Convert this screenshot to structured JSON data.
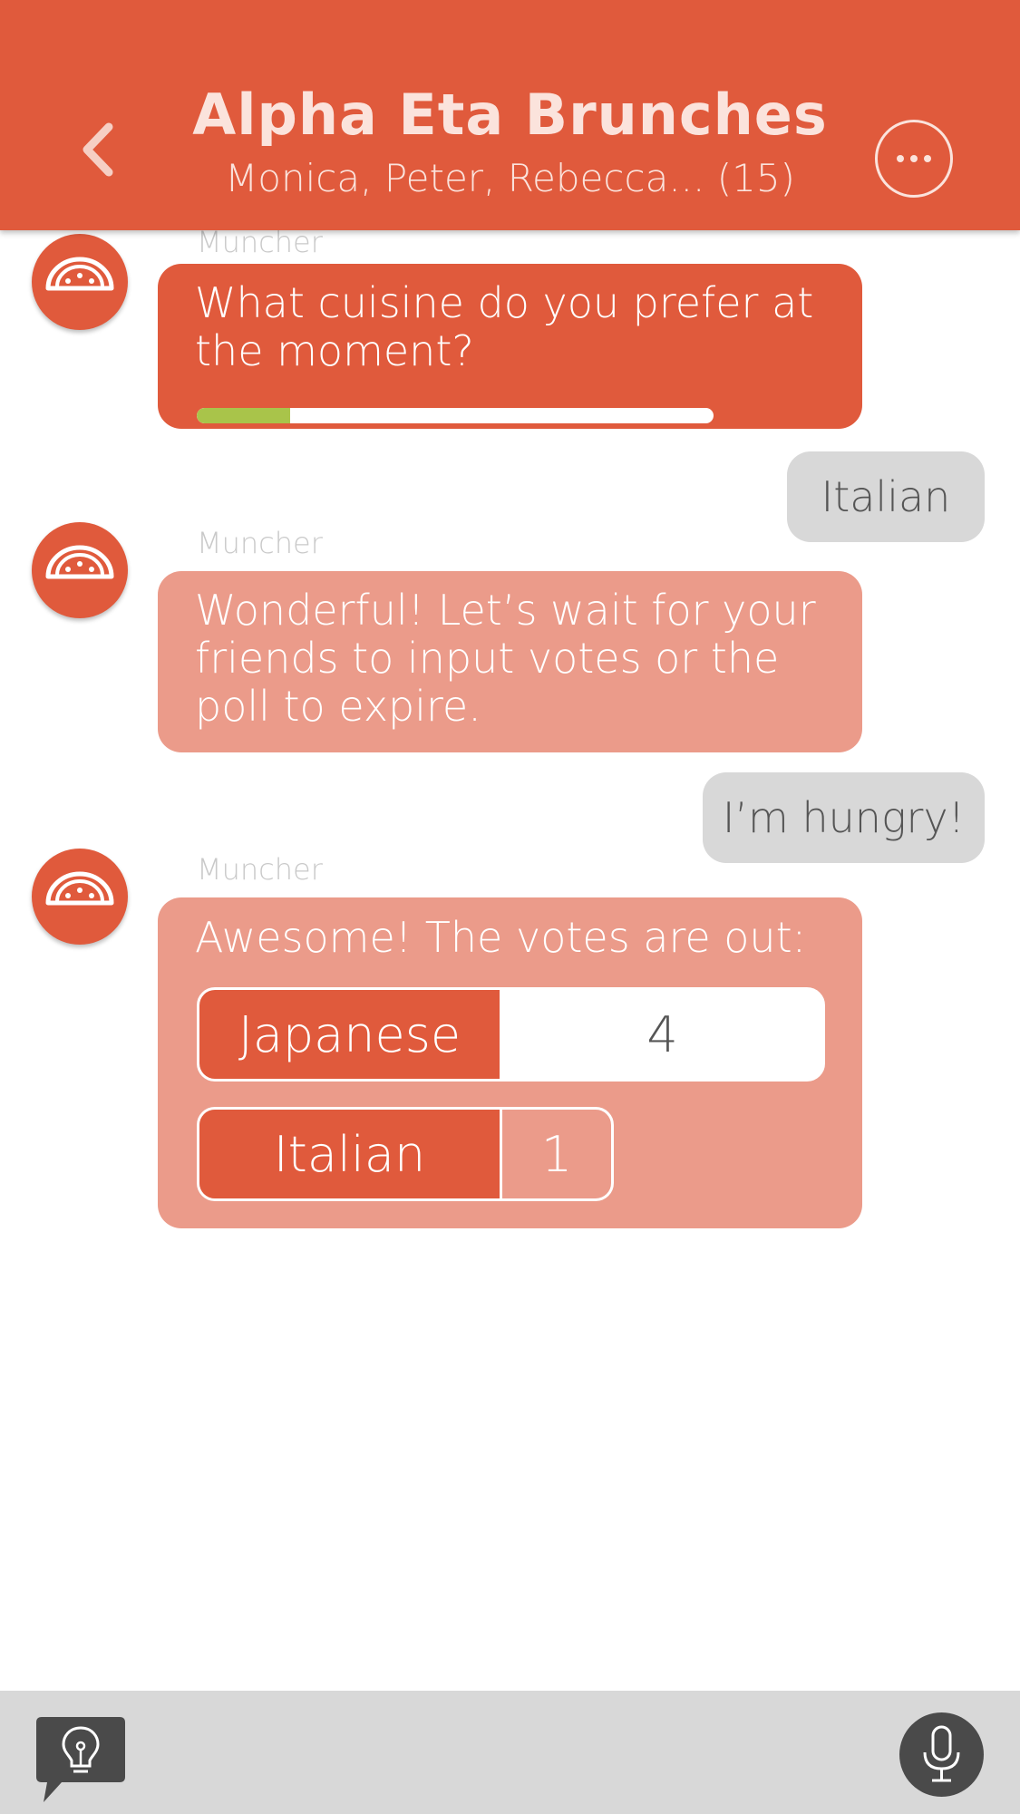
{
  "header": {
    "title": "Alpha Eta Brunches",
    "subtitle": "Monica, Peter, Rebecca... (15)",
    "back_icon": "chevron-left-icon",
    "more_icon": "ellipsis-icon"
  },
  "colors": {
    "brand": "#e05a3c",
    "bubble_light": "#eb9b8a",
    "user_bubble": "#d8d8d8",
    "progress": "#a9c44a",
    "bottom_bar": "#d8d8d8"
  },
  "messages": [
    {
      "sender": "Muncher",
      "text": "What cuisine do you prefer at the moment?",
      "poll_progress": 0.18
    },
    {
      "from_user": true,
      "text": "Italian"
    },
    {
      "sender": "Muncher",
      "text": "Wonderful! Let’s wait for your friends to input votes or the poll to expire."
    },
    {
      "from_user": true,
      "text": "I’m hungry!"
    },
    {
      "sender": "Muncher",
      "text": "Awesome! The votes are out:",
      "results": [
        {
          "label": "Japanese",
          "count": "4"
        },
        {
          "label": "Italian",
          "count": "1"
        }
      ]
    }
  ],
  "bottom_bar": {
    "idea_icon": "lightbulb-icon",
    "mic_icon": "microphone-icon"
  }
}
